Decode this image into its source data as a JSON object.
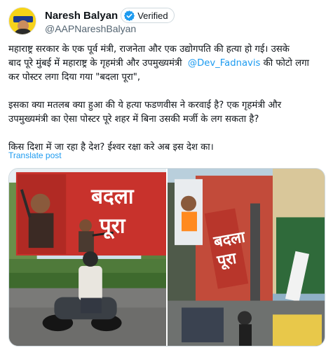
{
  "author": {
    "name": "Naresh Balyan",
    "handle": "@AAPNareshBalyan",
    "verified_label": "Verified"
  },
  "tweet": {
    "paragraph1_lines": [
      "महाराष्ट्र सरकार के एक पूर्व मंत्री, राजनेता और एक उद्योगपति की हत्या हो गई। उसके",
      "बाद पूरे मुंबई में महाराष्ट्र के गृहमंत्री और उपमुख्यमंत्री",
      "कर पोस्टर लगा दिया गया \"बदला पूरा\","
    ],
    "mention": "@Dev_Fadnavis",
    "mention_suffix": "की फोटो लगा",
    "paragraph2_lines": [
      "इसका क्या मतलब क्या हुआ की ये हत्या फडणवीस ने करवाई है? एक गृहमंत्री और",
      "उपमुख्यमंत्री का ऐसा पोस्टर पूरे शहर में बिना उसकी मर्जी के लग सकता है?"
    ],
    "paragraph3": "किस दिशा में जा रहा है देश? ईश्वर रक्षा करे अब इस देश का।",
    "translate_label": "Translate post"
  },
  "media": {
    "image1_poster_text": [
      "बदला",
      "पूरा"
    ],
    "image2_poster_text": [
      "बदला",
      "पूरा"
    ]
  },
  "colors": {
    "link": "#1d9bf0",
    "text": "#0f1419",
    "muted": "#536471",
    "poster_red": "#c8322c"
  }
}
